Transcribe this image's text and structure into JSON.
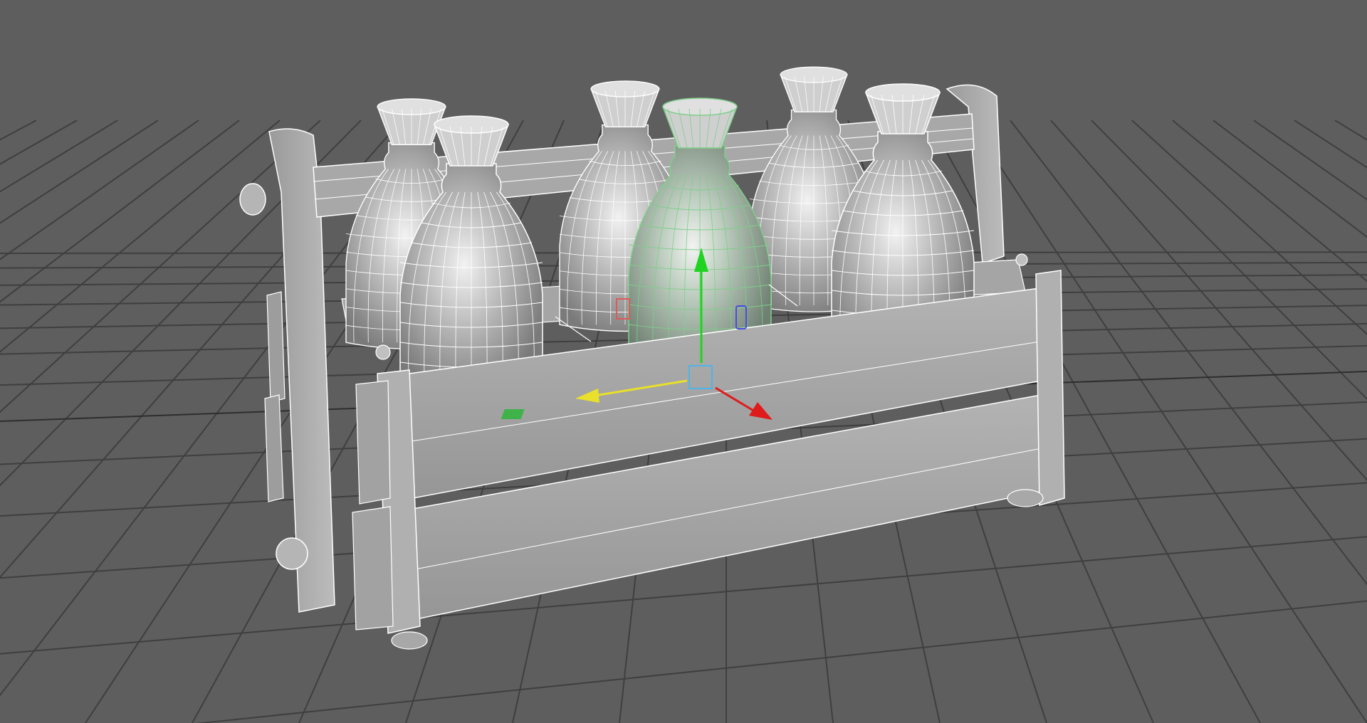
{
  "viewport": {
    "background_color": "#5e5e5e",
    "grid_color": "#3f3f3f",
    "grid_axis_color": "#2e2e2e"
  },
  "model": {
    "name": "bottle-crate",
    "bottle_count": 6,
    "wireframe_color": "#ffffff",
    "shaded_color": "#a9a9a9",
    "selected_color": "#7ecf8a"
  },
  "gizmo": {
    "type": "move-tool",
    "x_axis_color": "#e01b1b",
    "y_axis_color": "#21d321",
    "z_axis_color": "#e8e02a",
    "center_color": "#4fb3e8",
    "xy_plane_color": "#3fb34a",
    "yz_plane_color": "#e05a5a",
    "xz_plane_color": "#4c4ce0"
  }
}
